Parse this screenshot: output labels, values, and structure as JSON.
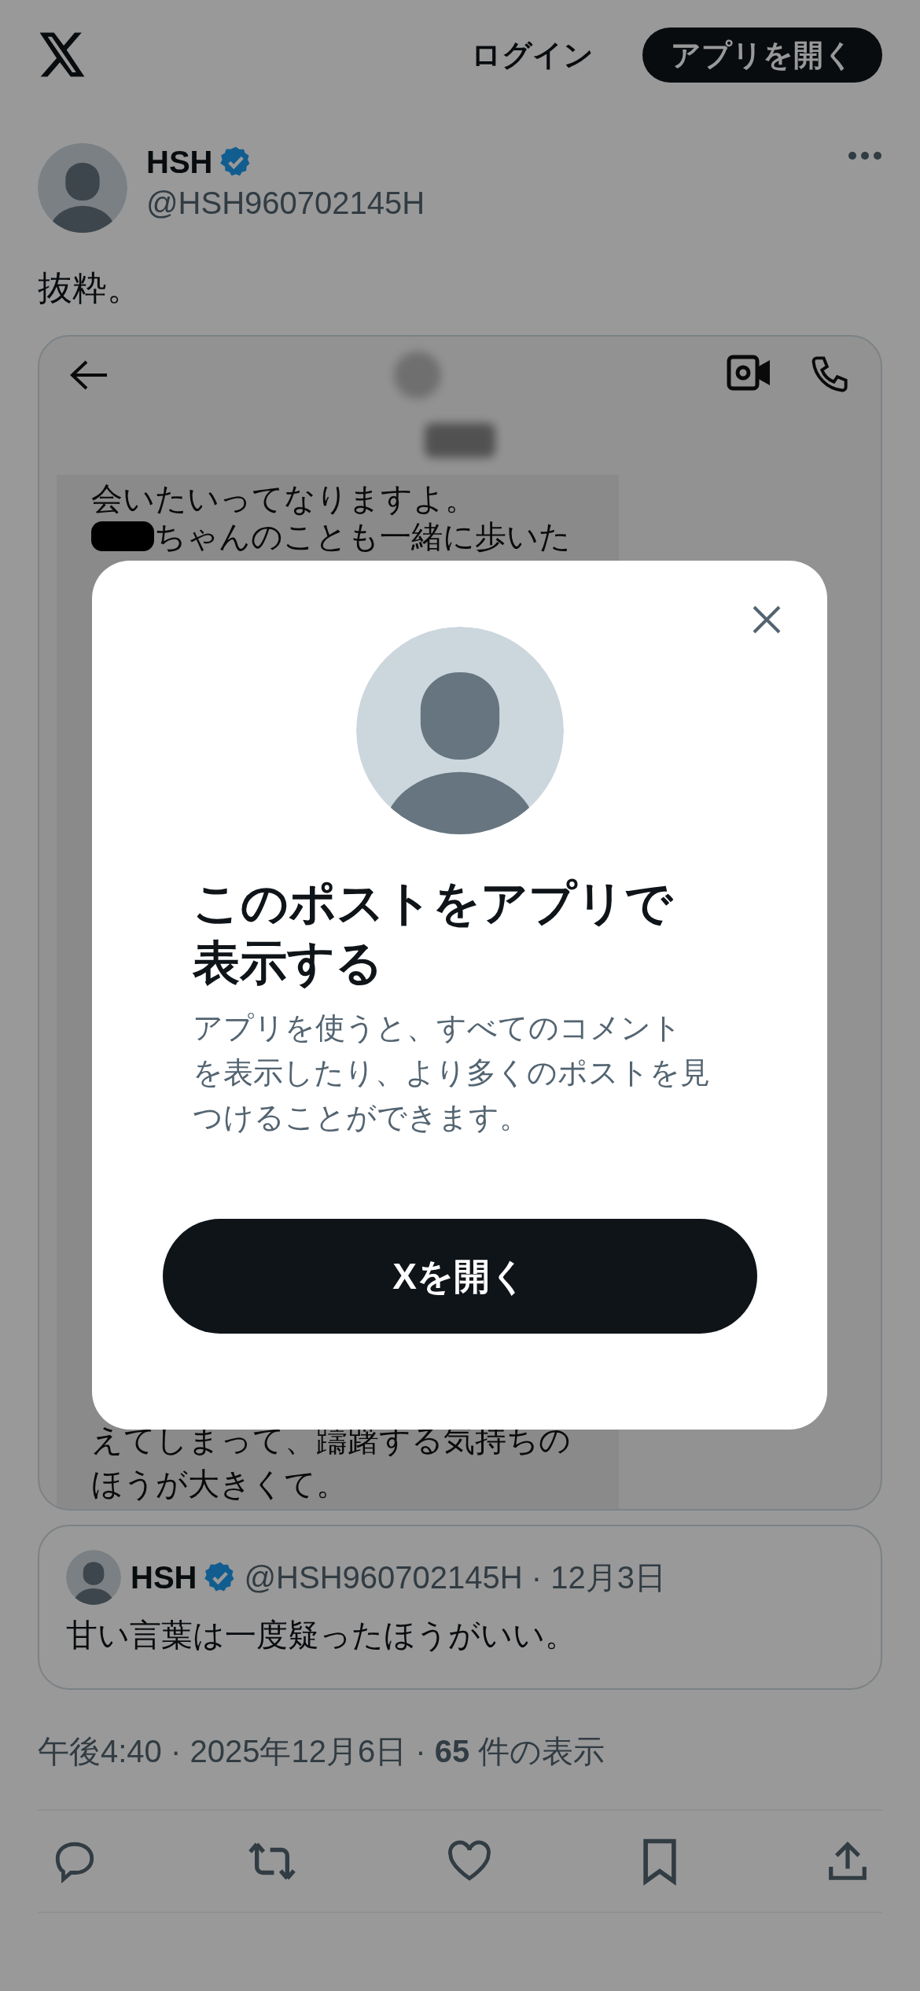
{
  "header": {
    "login": "ログイン",
    "open_app": "アプリを開く"
  },
  "post": {
    "author": {
      "name": "HSH",
      "verified": true,
      "handle": "@HSH960702145H"
    },
    "text": "抜粋。",
    "media": {
      "kind": "screenshot",
      "top_lines": [
        "会いたいってなりますよ。",
        "ちゃんのことも一緒に歩いた"
      ],
      "bottom_lines": [
        "えてしまって、躊躇する気持ちの",
        "ほうが大きくて。"
      ]
    },
    "quote": {
      "name": "HSH",
      "verified": true,
      "handle_date": "@HSH960702145H · 12月3日",
      "text": "甘い言葉は一度疑ったほうがいい。"
    },
    "meta": "午後4:40 · 2025年12月6日 · **65** 件の表示"
  },
  "modal": {
    "title": "このポストをアプリで表示する",
    "body": "アプリを使うと、すべてのコメントを表示したり、より多くのポストを見つけることができます。",
    "button": "Xを開く"
  }
}
